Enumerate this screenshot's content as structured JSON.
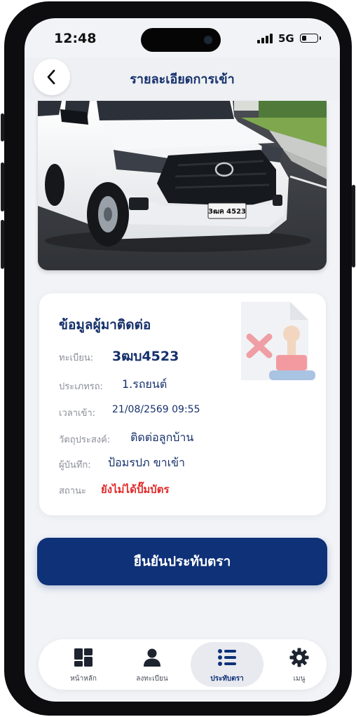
{
  "status_bar": {
    "time": "12:48",
    "network": "5G",
    "battery_level": 0.3
  },
  "header": {
    "title": "รายละเอียดการเข้า",
    "back_icon": "chevron-left-icon"
  },
  "vehicle_photo": {
    "plate_text": "3ฒค 4523"
  },
  "info_card": {
    "title": "ข้อมูลผู้มาติดต่อ",
    "fields": [
      {
        "label": "ทะเบียน:",
        "value": "3ฒบ4523"
      },
      {
        "label": "ประเภทรถ:",
        "value": "1.รถยนต์"
      },
      {
        "label": "เวลาเข้า:",
        "value": "21/08/2569 09:55"
      },
      {
        "label": "วัตถุประสงค์:",
        "value": "ติดต่อลูกบ้าน"
      },
      {
        "label": "ผู้บันทึก:",
        "value": "ป้อมรปภ ขาเข้า"
      },
      {
        "label": "สถานะ",
        "value": "ยังไม่ได้ปั๊มบัตร"
      }
    ],
    "status_color": "#e22a2a",
    "illustration_icon": "stamp-reject-icon"
  },
  "confirm_button": {
    "label": "ยืนยันประทับตรา"
  },
  "bottom_nav": {
    "items": [
      {
        "label": "หน้าหลัก",
        "icon": "dashboard-icon"
      },
      {
        "label": "ลงทะเบียน",
        "icon": "user-icon"
      },
      {
        "label": "ประทับตรา",
        "icon": "list-icon"
      },
      {
        "label": "เมนู",
        "icon": "gear-icon"
      }
    ],
    "active_label": "ประทับตรา"
  },
  "colors": {
    "primary": "#0e3178",
    "title_text": "#16316b",
    "background": "#f1f3f7"
  }
}
